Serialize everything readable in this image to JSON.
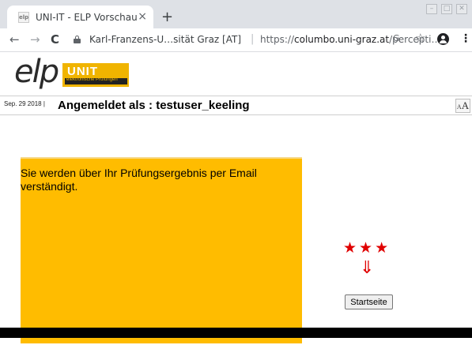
{
  "browser": {
    "tab_title": "UNI-IT - ELP Vorschau",
    "tab_favicon_text": "elp",
    "tab_close": "×",
    "new_tab": "+",
    "window_controls": [
      "–",
      "□",
      "✕"
    ],
    "nav": {
      "back": "←",
      "forward": "→",
      "reload": "C"
    },
    "url_site": "Karl-Franzens-U…sität Graz [AT]",
    "url_separator": "|",
    "url_scheme": "https://",
    "url_domain": "columbo.uni-graz.at",
    "url_path": "/percepti…",
    "translate_icon": "G",
    "star_icon": "☆",
    "menu_icon": "⋮"
  },
  "header": {
    "logo_elp": "elp",
    "logo_unit": "UNIT",
    "logo_sub": "elektronische Prüfungen",
    "date": "Sep. 29 2018 |",
    "login_text": "Angemeldet als : testuser_keeling",
    "font_size_label": "A"
  },
  "main": {
    "notice_text": "Sie werden über Ihr Prüfungsergebnis per Email verständigt.",
    "stars": "★★★",
    "arrow": "⇓",
    "start_button": "Startseite"
  },
  "colors": {
    "accent": "#ffbc00",
    "stars": "#e00000"
  }
}
